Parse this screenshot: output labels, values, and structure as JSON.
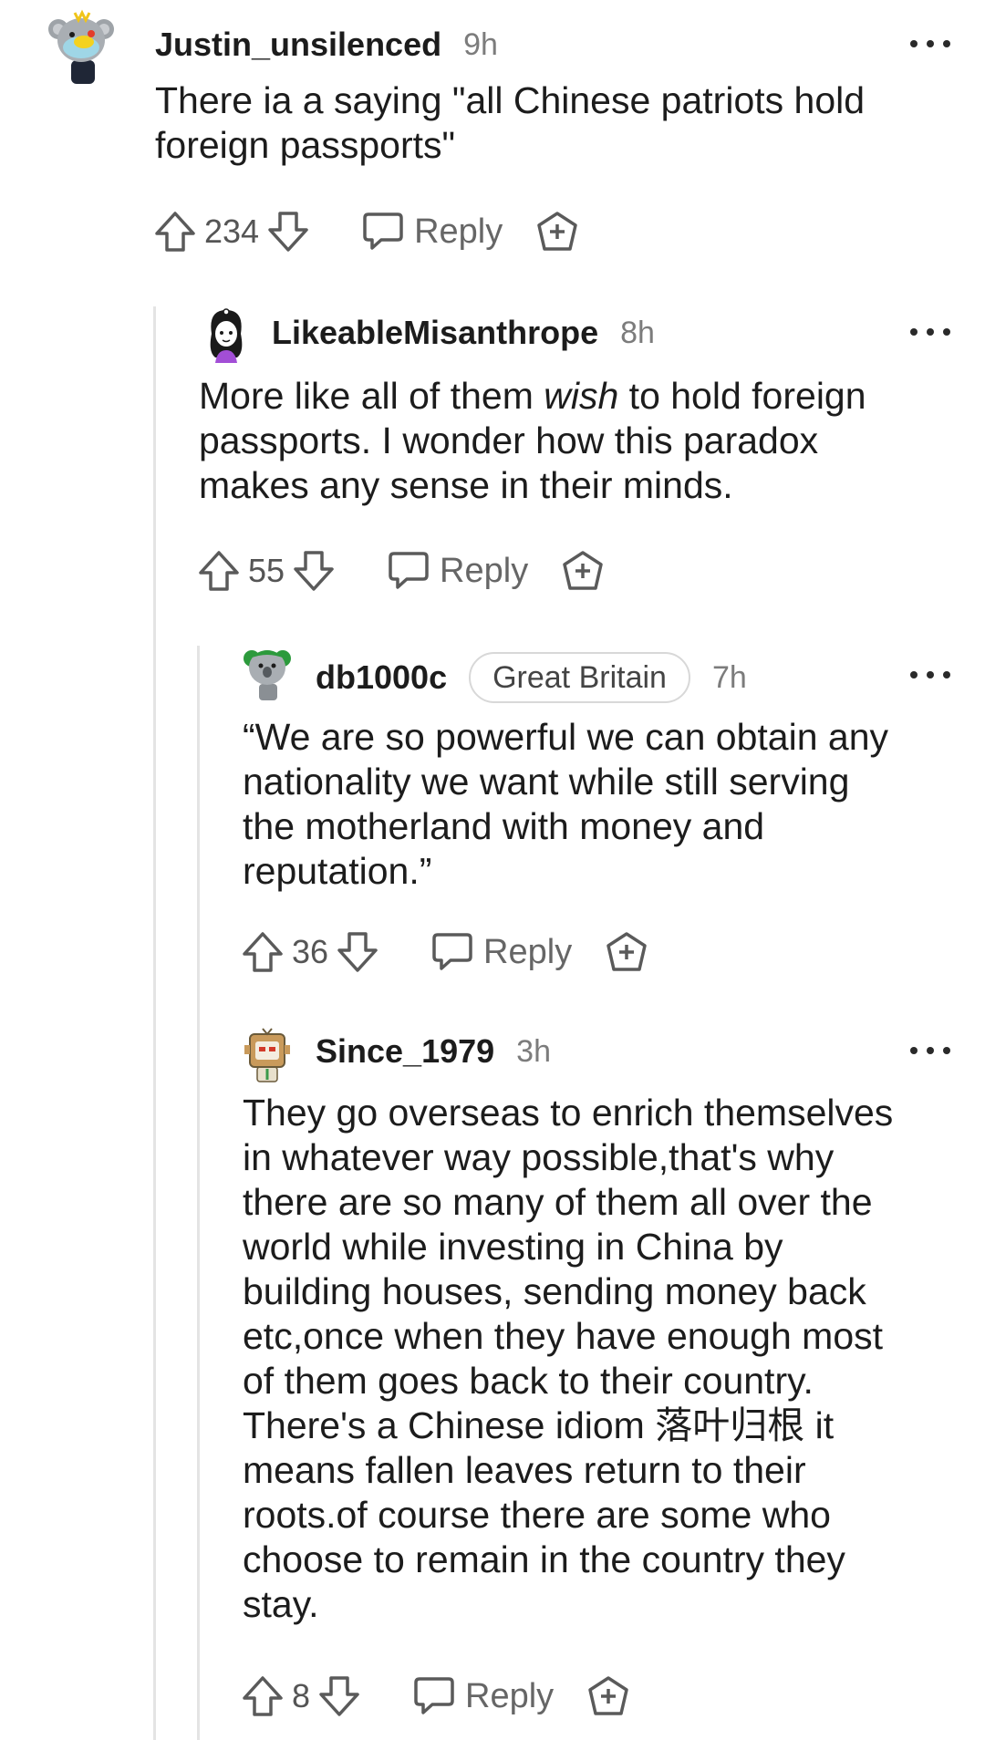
{
  "comments": [
    {
      "username": "Justin_unsilenced",
      "time": "9h",
      "body_lines": [
        "There ia a saying \"all Chinese patriots hold",
        "foreign passports\""
      ],
      "score": "234",
      "reply_label": "Reply"
    },
    {
      "username": "LikeableMisanthrope",
      "time": "8h",
      "body_line1_before": "More like all of them ",
      "body_line1_em": "wish",
      "body_line1_after": " to hold foreign",
      "body_lines_rest": [
        "passports. I wonder how this paradox",
        "makes any sense in their minds."
      ],
      "score": "55",
      "reply_label": "Reply"
    },
    {
      "username": "db1000c",
      "flair": "Great Britain",
      "time": "7h",
      "body_lines": [
        "“We are so powerful we can obtain any",
        "nationality we want while still serving",
        "the motherland with money and",
        "reputation.”"
      ],
      "score": "36",
      "reply_label": "Reply"
    },
    {
      "username": "Since_1979",
      "time": "3h",
      "body_lines": [
        "They go overseas to enrich themselves",
        "in whatever way possible,that's why",
        "there are so many of them all over the",
        "world while investing in China by",
        "building houses, sending money back",
        "etc,once when they have enough most",
        "of them goes back to their country.",
        "There's a Chinese idiom 落叶归根 it",
        "means fallen leaves return to their",
        "roots.of course there are some who",
        "choose to remain in the country they",
        "stay."
      ],
      "score": "8",
      "reply_label": "Reply"
    }
  ],
  "icons": {
    "upvote": "upvote-arrow-icon",
    "downvote": "downvote-arrow-icon",
    "reply": "chat-bubble-icon",
    "award": "award-plus-icon",
    "more": "more-options-icon"
  },
  "colors": {
    "text": "#1c1c1c",
    "muted": "#7c7c7c",
    "icon": "#5a5a5a",
    "thread_line": "#e4e4e4"
  }
}
